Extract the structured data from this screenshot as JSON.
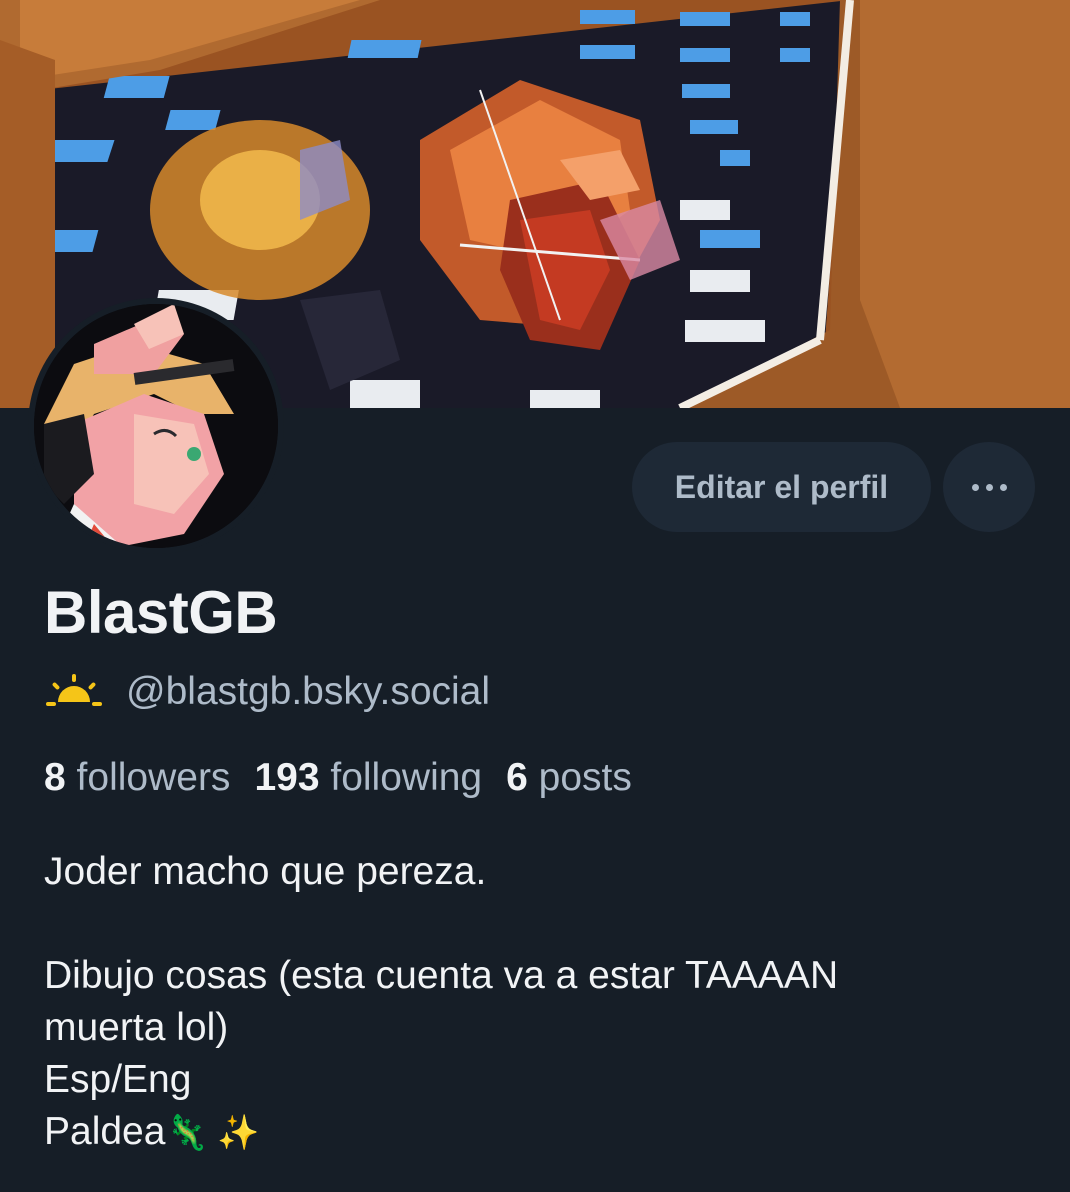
{
  "banner": {
    "name": "banner-image"
  },
  "avatar": {
    "name": "avatar"
  },
  "actions": {
    "edit_label": "Editar el perfil",
    "more_icon": "ellipsis-icon"
  },
  "profile": {
    "display_name": "BlastGB",
    "handle_icon": "sunrise-icon",
    "handle": "@blastgb.bsky.social"
  },
  "stats": {
    "followers_count": "8",
    "followers_label": "followers",
    "following_count": "193",
    "following_label": "following",
    "posts_count": "6",
    "posts_label": "posts"
  },
  "bio": {
    "line1": "Joder macho que pereza.",
    "line2": "",
    "line3": "Dibujo cosas (esta cuenta va a estar TAAAAN",
    "line4": "muerta lol)",
    "line5": "Esp/Eng",
    "line6_text": "Paldea",
    "line6_emoji": "🦎 ✨"
  },
  "colors": {
    "background": "#161e27",
    "button_bg": "#1e2936",
    "muted_text": "#aebbc9",
    "primary_text": "#f1f3f5",
    "sun_icon": "#f5c518"
  }
}
